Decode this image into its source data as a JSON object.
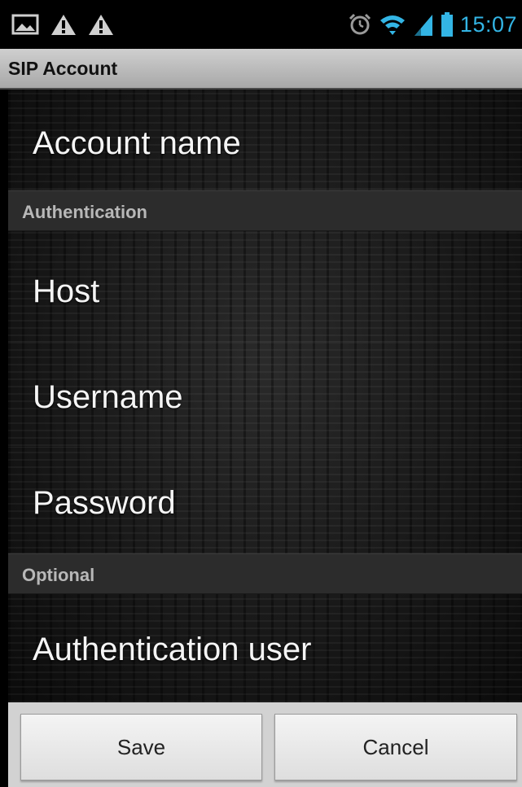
{
  "status_bar": {
    "time": "15:07",
    "notification_icons": [
      "image-icon",
      "warning-icon",
      "warning-icon"
    ],
    "system_icons": [
      "alarm-icon",
      "wifi-icon",
      "signal-icon",
      "battery-icon"
    ],
    "time_color": "#33b5e5"
  },
  "title_bar": {
    "title": "SIP Account"
  },
  "account": {
    "name_label": "Account name"
  },
  "sections": {
    "authentication": {
      "header": "Authentication",
      "host_label": "Host",
      "username_label": "Username",
      "password_label": "Password"
    },
    "optional": {
      "header": "Optional",
      "auth_user_label": "Authentication user"
    }
  },
  "buttons": {
    "save_label": "Save",
    "cancel_label": "Cancel"
  }
}
